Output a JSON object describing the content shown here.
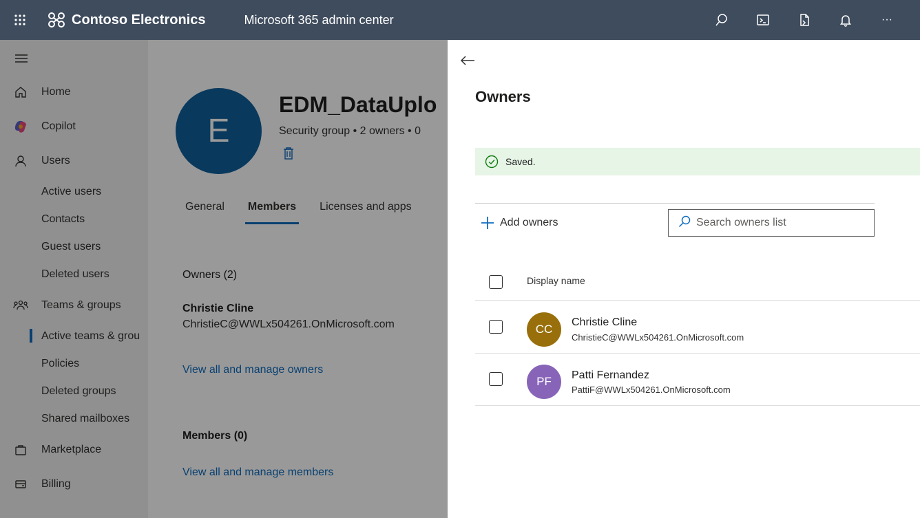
{
  "topbar": {
    "brand": "Contoso Electronics",
    "app_name": "Microsoft 365 admin center",
    "icons": [
      "waffle-icon",
      "search-icon",
      "terminal-icon",
      "document-icon",
      "bell-icon",
      "more-icon"
    ],
    "more_label": "···"
  },
  "sidebar": {
    "items": [
      {
        "label": "Home",
        "icon": "home-icon"
      },
      {
        "label": "Copilot",
        "icon": "copilot-icon"
      },
      {
        "label": "Users",
        "icon": "user-icon"
      },
      {
        "label": "Teams & groups",
        "icon": "teams-icon"
      },
      {
        "label": "Marketplace",
        "icon": "bag-icon"
      },
      {
        "label": "Billing",
        "icon": "card-icon"
      }
    ],
    "users_sub": [
      "Active users",
      "Contacts",
      "Guest users",
      "Deleted users"
    ],
    "teams_sub": [
      "Active teams & grou",
      "Policies",
      "Deleted groups",
      "Shared mailboxes"
    ]
  },
  "group": {
    "initial": "E",
    "title": "EDM_DataUplo",
    "subtitle": "Security group  •  2 owners  •  0",
    "tabs": [
      "General",
      "Members",
      "Licenses and apps"
    ],
    "owners_label": "Owners (2)",
    "owner_name": "Christie Cline",
    "owner_email": "ChristieC@WWLx504261.OnMicrosoft.com",
    "manage_owners_link": "View all and manage owners",
    "members_label": "Members (0)",
    "manage_members_link": "View all and manage members"
  },
  "panel": {
    "title": "Owners",
    "saved_message": "Saved.",
    "add_owners_label": "Add owners",
    "search_placeholder": "Search owners list",
    "column_header": "Display name",
    "rows": [
      {
        "initials": "CC",
        "name": "Christie Cline",
        "email": "ChristieC@WWLx504261.OnMicrosoft.com",
        "color": "#986f0b"
      },
      {
        "initials": "PF",
        "name": "Patti Fernandez",
        "email": "PattiF@WWLx504261.OnMicrosoft.com",
        "color": "#8764b8"
      }
    ]
  },
  "colors": {
    "topbar": "#3f4c5d",
    "accent": "#0f6cbd",
    "saved_bg": "#e6f5e6",
    "avatar_group": "#0f5f9b"
  }
}
